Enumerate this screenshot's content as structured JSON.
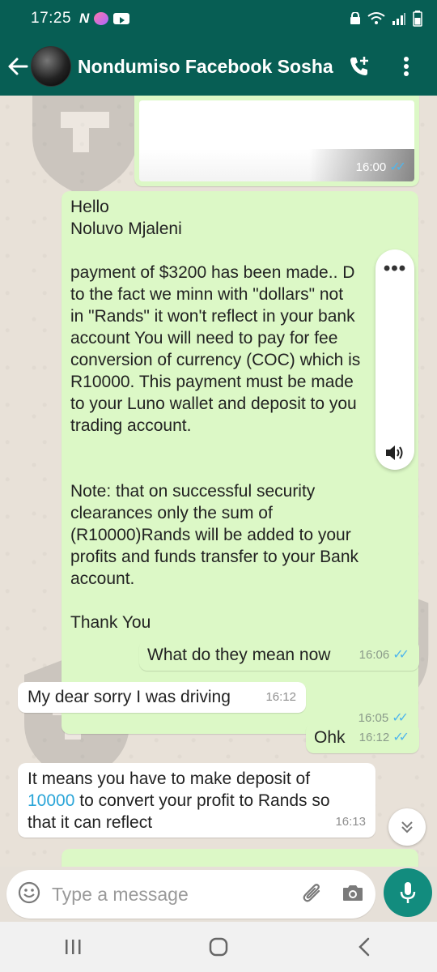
{
  "status_bar": {
    "time": "17:25",
    "notification_icons": [
      "n-icon",
      "messenger-icon",
      "youtube-icon"
    ],
    "system_icons": [
      "lock-icon",
      "wifi-call-icon",
      "signal-icon",
      "battery-icon"
    ]
  },
  "header": {
    "contact_name": "Nondumiso Facebook Sosha",
    "icons": [
      "back-arrow-icon",
      "add-call-icon",
      "more-vert-icon"
    ]
  },
  "messages": [
    {
      "id": "img",
      "type": "image",
      "direction": "out",
      "time": "16:00",
      "status": "read"
    },
    {
      "id": "m1",
      "type": "text",
      "direction": "out",
      "time": "16:05",
      "status": "read",
      "lines": [
        "Hello",
        "Noluvo Mjaleni",
        "",
        "payment of $3200 has been made.. D",
        "to the fact we minn with \"dollars\" not",
        "in \"Rands\" it won't reflect in your bank",
        "account You will need to pay for fee",
        "conversion of currency (COC) which is",
        "R10000. This payment must be made",
        "to your Luno wallet and deposit to you",
        "trading account.",
        "",
        "",
        "Note: that on successful security",
        "clearances only the sum of",
        "(R10000)Rands will be added to your",
        "profits and funds transfer to your Bank",
        "account.",
        "",
        "Thank You"
      ]
    },
    {
      "id": "m2",
      "type": "text",
      "direction": "out",
      "text": "What do they mean now",
      "time": "16:06",
      "status": "read"
    },
    {
      "id": "m3",
      "type": "text",
      "direction": "in",
      "text": "My dear sorry I was driving",
      "time": "16:12"
    },
    {
      "id": "m4",
      "type": "text",
      "direction": "out",
      "text": "Ohk",
      "time": "16:12",
      "status": "read"
    },
    {
      "id": "m5",
      "type": "text",
      "direction": "in",
      "time": "16:13",
      "line1": "It means you have to make deposit of",
      "link": "10000",
      "line2_rest": " to convert your profit to Rands so",
      "line3": "that it can reflect"
    }
  ],
  "input": {
    "placeholder": "Type a message"
  },
  "nav": {
    "icons": [
      "recents-icon",
      "home-icon",
      "back-icon"
    ]
  },
  "colors": {
    "header": "#075e54",
    "outgoing_bubble": "#dcf8c6",
    "incoming_bubble": "#ffffff",
    "read_ticks": "#4fb6ec",
    "mic_button": "#128c7e",
    "link": "#2aa5d8"
  }
}
